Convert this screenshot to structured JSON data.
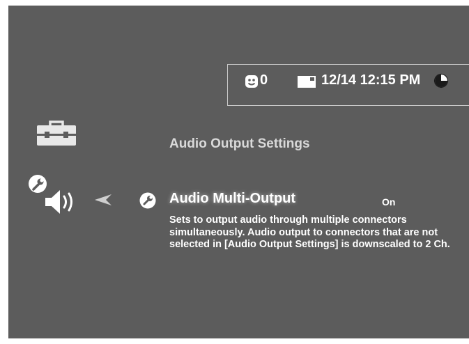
{
  "status_bar": {
    "friends_count": "0",
    "datetime": "12/14 12:15 PM",
    "icons": [
      "face-icon",
      "message-icon",
      "clock-icon"
    ]
  },
  "category": {
    "icon": "toolbox-icon"
  },
  "submenu": {
    "icon": "sound-settings-icon",
    "back_icon": "back-arrow-icon"
  },
  "settings": {
    "title": "Audio Output Settings",
    "item": {
      "icon": "wrench-icon",
      "label": "Audio Multi-Output",
      "value": "On",
      "description": "Sets to output audio through multiple connectors simultaneously. Audio output to connectors that are not selected in [Audio Output Settings] is downscaled to 2 Ch."
    }
  },
  "colors": {
    "background": "#5c5c5c",
    "text": "#ffffff",
    "muted_text": "#d9d9d9",
    "frame": "#c8c8c8"
  }
}
